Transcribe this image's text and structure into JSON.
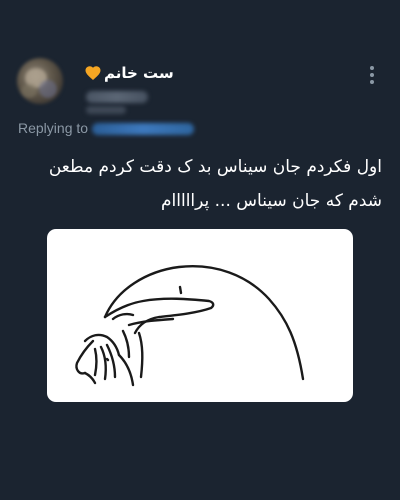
{
  "tweet": {
    "author": {
      "display_name": "ست خانم",
      "badge_icon": "orange-heart-icon",
      "badge_color": "#f5a623",
      "handle_redacted": true,
      "avatar_redacted": true
    },
    "menu_icon": "more-vertical-icon",
    "replying_to": {
      "label": "Replying to",
      "handle_redacted": true,
      "link_color": "#1d9bf0"
    },
    "text_lines": [
      "اول فکردم جان سیناس بد ک دقت کردم مطعن",
      "شدم که جان سیناس ... پرااااام"
    ],
    "media": {
      "type": "image",
      "description_icon": "doodle-flork-meme-image",
      "background": "#ffffff"
    }
  },
  "colors": {
    "background": "#1b2430",
    "text_primary": "#ffffff",
    "text_secondary": "#8b98a5"
  }
}
